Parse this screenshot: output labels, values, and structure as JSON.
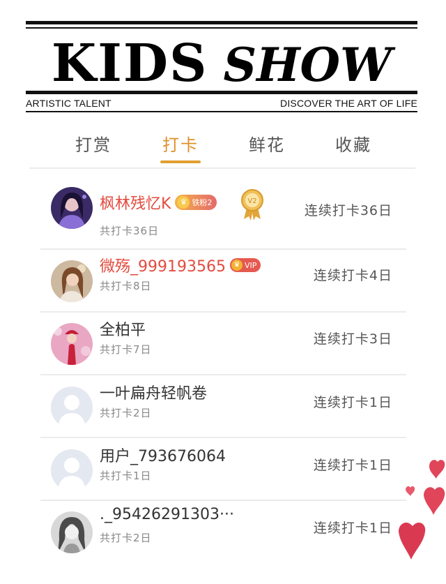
{
  "header": {
    "title_word1": "KIDS",
    "title_word2": "SHOW",
    "tagline_left": "ARTISTIC TALENT",
    "tagline_right": "DISCOVER THE ART OF LIFE"
  },
  "tabs": [
    {
      "label": "打赏",
      "active": false
    },
    {
      "label": "打卡",
      "active": true
    },
    {
      "label": "鲜花",
      "active": false
    },
    {
      "label": "收藏",
      "active": false
    }
  ],
  "colors": {
    "accent": "#e0902a",
    "vip_name": "#e34b3f",
    "text_muted": "#888888"
  },
  "users": [
    {
      "name": "枫林残忆K",
      "badge": "铁粉2",
      "medal": "V2",
      "total": "共打卡36日",
      "streak": "连续打卡36日",
      "avatar": "avatar-photo-girl-purple"
    },
    {
      "name": "微殇_999193565",
      "badge": "VIP",
      "total": "共打卡8日",
      "streak": "连续打卡4日",
      "avatar": "avatar-photo-girl-brown"
    },
    {
      "name": "全柏平",
      "total": "共打卡7日",
      "streak": "连续打卡3日",
      "avatar": "avatar-photo-girl-red"
    },
    {
      "name": "一叶扁舟轻帆卷",
      "total": "共打卡2日",
      "streak": "连续打卡1日",
      "avatar": "default-avatar-icon"
    },
    {
      "name": "用户_793676064",
      "total": "共打卡1日",
      "streak": "连续打卡1日",
      "avatar": "default-avatar-icon"
    },
    {
      "name": "._95426291303···",
      "total": "共打卡2日",
      "streak": "连续打卡1日",
      "avatar": "avatar-photo-girl-bw"
    }
  ]
}
